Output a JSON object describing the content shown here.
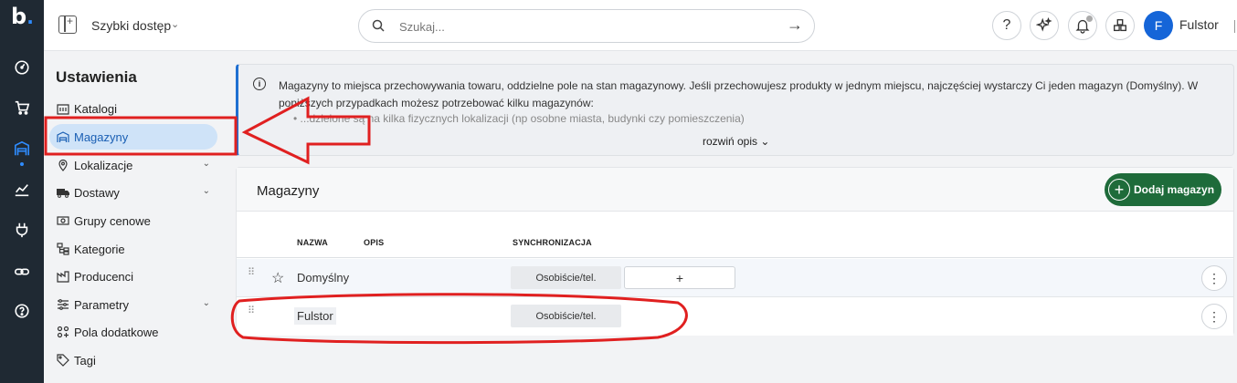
{
  "app": {
    "logo": "b",
    "logo_dot": "."
  },
  "rail": {
    "items": [
      {
        "icon": "dashboard-icon"
      },
      {
        "icon": "cart-icon"
      },
      {
        "icon": "warehouse-icon"
      },
      {
        "icon": "chart-icon"
      },
      {
        "icon": "plug-icon"
      },
      {
        "icon": "link-icon"
      },
      {
        "icon": "help-icon"
      }
    ]
  },
  "topbar": {
    "quick_access": "Szybki dostęp",
    "search_placeholder": "Szukaj...",
    "help": "?",
    "user_initial": "F",
    "user_name": "Fulstor"
  },
  "sidebar": {
    "title": "Ustawienia",
    "items": [
      {
        "label": "Katalogi",
        "icon": "catalog-icon"
      },
      {
        "label": "Magazyny",
        "icon": "warehouse-icon",
        "active": true
      },
      {
        "label": "Lokalizacje",
        "icon": "location-pin-icon",
        "expandable": true
      },
      {
        "label": "Dostawy",
        "icon": "truck-icon",
        "expandable": true
      },
      {
        "label": "Grupy cenowe",
        "icon": "money-icon"
      },
      {
        "label": "Kategorie",
        "icon": "tree-icon"
      },
      {
        "label": "Producenci",
        "icon": "factory-icon"
      },
      {
        "label": "Parametry",
        "icon": "sliders-icon",
        "expandable": true
      },
      {
        "label": "Pola dodatkowe",
        "icon": "fields-icon"
      },
      {
        "label": "Tagi",
        "icon": "tag-icon"
      }
    ]
  },
  "info": {
    "text": "Magazyny to miejsca przechowywania towaru, oddzielne pole na stan magazynowy. Jeśli przechowujesz produkty w jednym miejscu, najczęściej wystarczy Ci jeden magazyn (Domyślny). W poniższych przypadkach możesz potrzebować kilku magazynów:",
    "faded": "• ...dzielone są na kilka fizycznych lokalizacji (np osobne miasta, budynki czy pomieszczenia)",
    "expand": "rozwiń opis ⌄"
  },
  "card": {
    "title": "Magazyny",
    "add_button": "Dodaj magazyn",
    "columns": {
      "name": "NAZWA",
      "desc": "OPIS",
      "sync": "SYNCHRONIZACJA"
    },
    "rows": [
      {
        "name": "Domyślny",
        "sync": "Osobiście/tel.",
        "add": "+",
        "default": true
      },
      {
        "name": "Fulstor",
        "sync": "Osobiście/tel."
      }
    ],
    "more": "⋮"
  }
}
